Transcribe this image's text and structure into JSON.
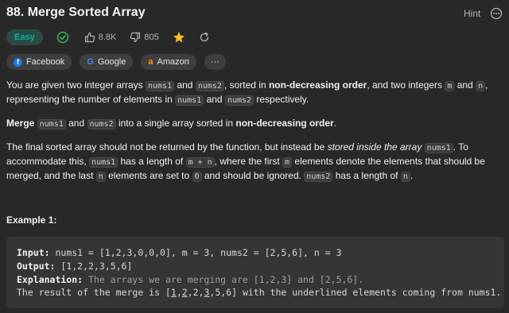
{
  "problem": {
    "title": "88. Merge Sorted Array",
    "hint_label": "Hint",
    "difficulty": "Easy",
    "likes": "8.8K",
    "dislikes": "805"
  },
  "companies": [
    {
      "label": "Facebook",
      "logo": "f"
    },
    {
      "label": "Google",
      "logo": "G"
    },
    {
      "label": "Amazon",
      "logo": "a"
    }
  ],
  "more_tags_label": "···",
  "description": {
    "p1": {
      "t1": "You are given two integer arrays ",
      "c1": "nums1",
      "t2": " and ",
      "c2": "nums2",
      "t3": ", sorted in ",
      "b1": "non-decreasing order",
      "t4": ", and two integers ",
      "c3": "m",
      "t5": " and ",
      "c4": "n",
      "t6": ", representing the number of elements in ",
      "c5": "nums1",
      "t7": " and ",
      "c6": "nums2",
      "t8": " respectively."
    },
    "p2": {
      "b1": "Merge",
      "t1": " ",
      "c1": "nums1",
      "t2": " and ",
      "c2": "nums2",
      "t3": " into a single array sorted in ",
      "b2": "non-decreasing order",
      "t4": "."
    },
    "p3": {
      "t1": "The final sorted array should not be returned by the function, but instead be ",
      "i1": "stored inside the array",
      "t2": " ",
      "c1": "nums1",
      "t3": ". To accommodate this, ",
      "c2": "nums1",
      "t4": " has a length of ",
      "c3": "m + n",
      "t5": ", where the first ",
      "c4": "m",
      "t6": " elements denote the elements that should be merged, and the last ",
      "c5": "n",
      "t7": " elements are set to ",
      "c6": "0",
      "t8": " and should be ignored. ",
      "c7": "nums2",
      "t9": " has a length of ",
      "c8": "n",
      "t10": "."
    }
  },
  "example": {
    "title": "Example 1:",
    "input_label": "Input:",
    "input_value": " nums1 = [1,2,3,0,0,0], m = 3, nums2 = [2,5,6], n = 3",
    "output_label": "Output:",
    "output_value": " [1,2,2,3,5,6]",
    "explanation_label": "Explanation:",
    "explanation_value": " The arrays we are merging are [1,2,3] and [2,5,6].",
    "result_text_1": "The result of the merge is [",
    "result_u1": "1",
    "result_c1": ",",
    "result_u2": "2",
    "result_c2": ",2,",
    "result_u3": "3",
    "result_c3": ",5,6] with the underlined elements coming from nums1."
  },
  "colors": {
    "background": "#282828",
    "easy": "#00b8a3",
    "check": "#2cbb5d",
    "star": "#ffc01e"
  }
}
